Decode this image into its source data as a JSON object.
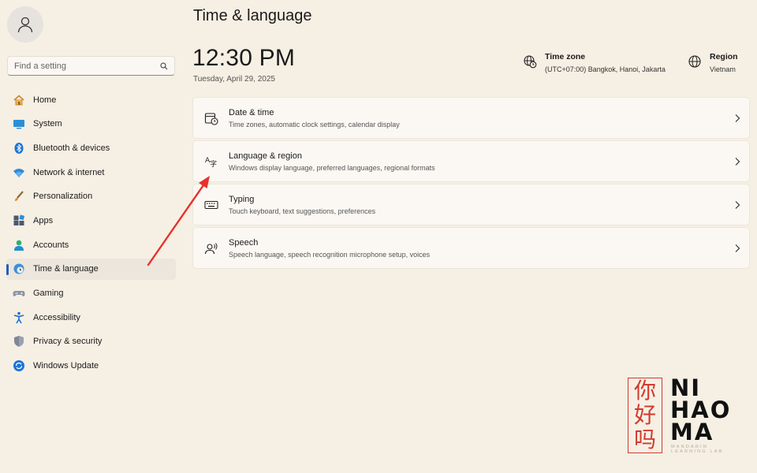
{
  "sidebar": {
    "search": {
      "placeholder": "Find a setting"
    },
    "items": [
      {
        "label": "Home",
        "icon": "home-icon"
      },
      {
        "label": "System",
        "icon": "system-icon"
      },
      {
        "label": "Bluetooth & devices",
        "icon": "bluetooth-icon"
      },
      {
        "label": "Network & internet",
        "icon": "wifi-icon"
      },
      {
        "label": "Personalization",
        "icon": "brush-icon"
      },
      {
        "label": "Apps",
        "icon": "apps-icon"
      },
      {
        "label": "Accounts",
        "icon": "accounts-icon"
      },
      {
        "label": "Time & language",
        "icon": "time-language-icon",
        "active": true
      },
      {
        "label": "Gaming",
        "icon": "gaming-icon"
      },
      {
        "label": "Accessibility",
        "icon": "accessibility-icon"
      },
      {
        "label": "Privacy & security",
        "icon": "shield-icon"
      },
      {
        "label": "Windows Update",
        "icon": "update-icon"
      }
    ]
  },
  "header": {
    "title": "Time & language"
  },
  "clock": {
    "time": "12:30 PM",
    "date": "Tuesday, April 29, 2025"
  },
  "timezone": {
    "label": "Time zone",
    "value": "(UTC+07:00) Bangkok, Hanoi, Jakarta"
  },
  "region": {
    "label": "Region",
    "value": "Vietnam"
  },
  "cards": [
    {
      "title": "Date & time",
      "subtitle": "Time zones, automatic clock settings, calendar display",
      "icon": "calendar-clock-icon"
    },
    {
      "title": "Language & region",
      "subtitle": "Windows display language, preferred languages, regional formats",
      "icon": "language-icon"
    },
    {
      "title": "Typing",
      "subtitle": "Touch keyboard, text suggestions, preferences",
      "icon": "keyboard-icon"
    },
    {
      "title": "Speech",
      "subtitle": "Speech language, speech recognition microphone setup, voices",
      "icon": "speech-icon"
    }
  ],
  "colors": {
    "accent": "#1f5fbf",
    "annotation_arrow": "#e8302a",
    "logo_red": "#d23a2e"
  },
  "logo": {
    "han_1": "你",
    "han_2": "好",
    "han_3": "吗",
    "line_1": "NI",
    "line_2": "HAO",
    "line_3": "MA",
    "tagline": "MANDARIN LEARNING LAB"
  }
}
